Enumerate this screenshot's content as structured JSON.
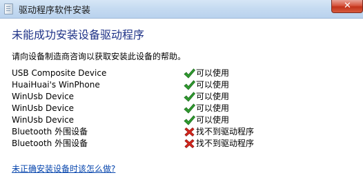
{
  "window": {
    "title": "驱动程序软件安装",
    "close_glyph": "✕"
  },
  "content": {
    "heading": "未能成功安装设备驱动程序",
    "instruction": "请向设备制造商咨询以获取安装此设备的帮助。",
    "devices": [
      {
        "name": "USB Composite Device",
        "status": "可以使用",
        "icon": "check-icon"
      },
      {
        "name": "HuaiHuai's WinPhone",
        "status": "可以使用",
        "icon": "check-icon"
      },
      {
        "name": "WinUsb Device",
        "status": "可以使用",
        "icon": "check-icon"
      },
      {
        "name": "WinUsb Device",
        "status": "可以使用",
        "icon": "check-icon"
      },
      {
        "name": "WinUsb Device",
        "status": "可以使用",
        "icon": "check-icon"
      },
      {
        "name": "Bluetooth 外围设备",
        "status": "找不到驱动程序",
        "icon": "error-x-icon"
      },
      {
        "name": "Bluetooth 外围设备",
        "status": "找不到驱动程序",
        "icon": "error-x-icon"
      }
    ],
    "help_link": "未正确安装设备时该怎么做?"
  },
  "colors": {
    "heading": "#1e3287",
    "link": "#0645ad",
    "success": "#2f9a2f",
    "error": "#d7261c"
  }
}
